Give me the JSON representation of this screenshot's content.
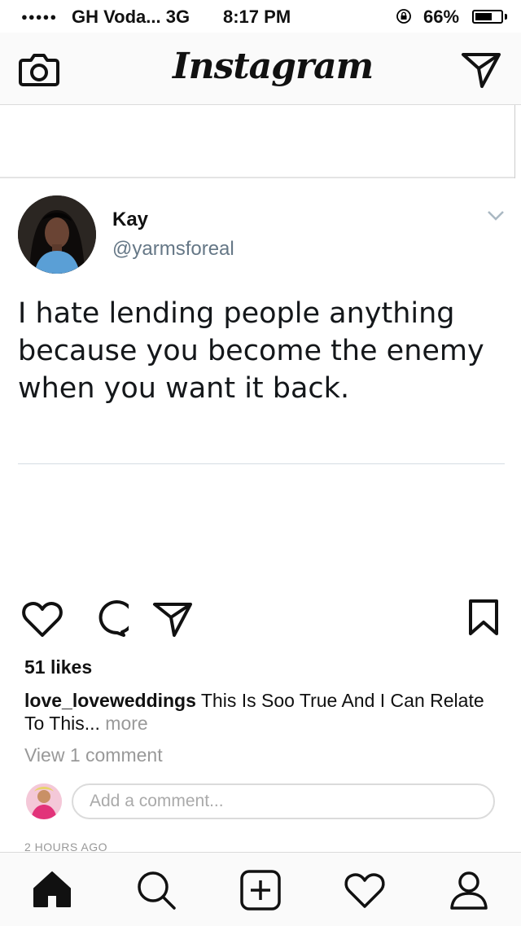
{
  "status_bar": {
    "signal": "●●●●●",
    "carrier": "GH Voda...  3G",
    "time": "8:17 PM",
    "battery_percent": "66%",
    "battery_level": 0.66
  },
  "nav": {
    "logo_text": "Instagram",
    "camera_icon": "camera-icon",
    "direct_icon": "paper-plane-icon"
  },
  "tweet": {
    "name": "Kay",
    "handle": "@yarmsforeal",
    "text": "I hate lending people anything because you become the enemy when you want it back."
  },
  "post": {
    "likes": "51 likes",
    "caption_user": "love_loveweddings",
    "caption_text": " This Is Soo True And I Can Relate To This... ",
    "caption_more": "more",
    "view_comments": "View 1 comment",
    "add_comment_placeholder": "Add a comment...",
    "time_ago": "2 HOURS AGO"
  },
  "tabs": [
    {
      "name": "home",
      "icon": "home-icon",
      "active": true
    },
    {
      "name": "search",
      "icon": "search-icon"
    },
    {
      "name": "add",
      "icon": "plus-icon"
    },
    {
      "name": "activity",
      "icon": "heart-icon"
    },
    {
      "name": "profile",
      "icon": "person-icon"
    }
  ]
}
